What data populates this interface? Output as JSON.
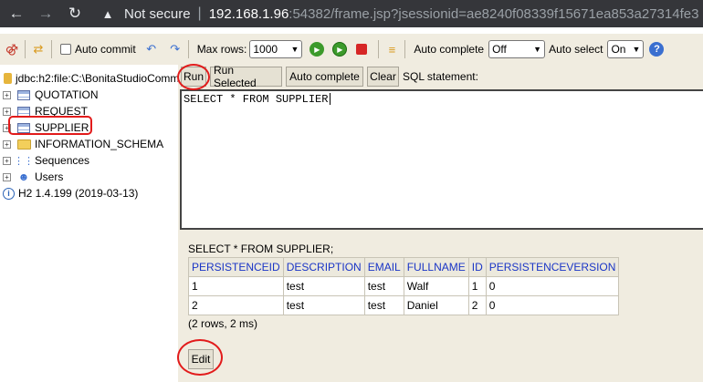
{
  "browser": {
    "security_label": "Not secure",
    "separator": "|",
    "url_host": "192.168.1.96",
    "url_rest": ":54382/frame.jsp?jsessionid=ae8240f08339f15671ea853a27314fe3"
  },
  "toolbar": {
    "auto_commit_label": "Auto commit",
    "max_rows_label": "Max rows:",
    "max_rows_value": "1000",
    "auto_complete_label": "Auto complete",
    "auto_complete_value": "Off",
    "auto_select_label": "Auto select",
    "auto_select_value": "On",
    "help_glyph": "?"
  },
  "tree": {
    "connection": "jdbc:h2:file:C:\\BonitaStudioComm",
    "tables": [
      "QUOTATION",
      "REQUEST",
      "SUPPLIER"
    ],
    "schema": "INFORMATION_SCHEMA",
    "sequences": "Sequences",
    "users": "Users",
    "version": "H2 1.4.199 (2019-03-13)"
  },
  "query_bar": {
    "run": "Run",
    "run_selected": "Run Selected",
    "auto_complete": "Auto complete",
    "clear": "Clear",
    "sql_statement_label": "SQL statement:"
  },
  "editor": {
    "text": "SELECT * FROM SUPPLIER"
  },
  "result": {
    "title": "SELECT * FROM SUPPLIER;",
    "columns": [
      "PERSISTENCEID",
      "DESCRIPTION",
      "EMAIL",
      "FULLNAME",
      "ID",
      "PERSISTENCEVERSION"
    ],
    "rows": [
      [
        "1",
        "test",
        "test",
        "Walf",
        "1",
        "0"
      ],
      [
        "2",
        "test",
        "test",
        "Daniel",
        "2",
        "0"
      ]
    ],
    "row_count": "(2 rows, 2 ms)",
    "edit_label": "Edit"
  },
  "colors": {
    "panel_bg": "#f0ece0",
    "header_text": "#1a35c6",
    "annotation": "#e21b1b",
    "chrome_bg": "#35363a"
  }
}
